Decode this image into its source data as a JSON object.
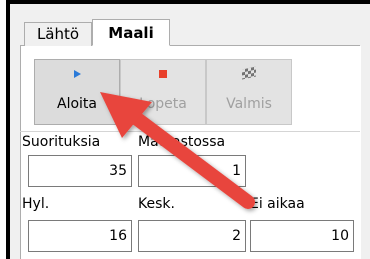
{
  "tabs": [
    {
      "label": "Lähtö",
      "active": false
    },
    {
      "label": "Maali",
      "active": true
    }
  ],
  "toolbar": {
    "start_label": "Aloita",
    "stop_label": "Lopeta",
    "finish_label": "Valmis",
    "start_icon": "play-icon",
    "stop_icon": "stop-icon",
    "finish_icon": "checkered-flag-icon",
    "start_icon_color": "#2b7ad8",
    "stop_icon_color": "#e8402b"
  },
  "stats": {
    "performances_label": "Suorituksia",
    "performances_value": "35",
    "on_course_label": "Matkastossa",
    "on_course_value": "1",
    "rejected_label": "Hyl.",
    "rejected_value": "16",
    "abandoned_label": "Kesk.",
    "abandoned_value": "2",
    "no_time_label": "Ei aikaa",
    "no_time_value": "10"
  },
  "annotation": {
    "color": "#e8453c"
  }
}
